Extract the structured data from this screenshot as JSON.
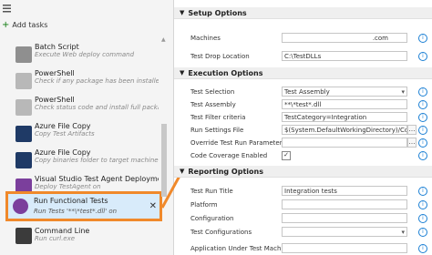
{
  "sidebar": {
    "add_tasks_label": "Add tasks",
    "tasks": [
      {
        "name": "Batch Script",
        "desc": "Execute Web deploy command",
        "icon": "batch-script-icon",
        "color": "#8f8f8f"
      },
      {
        "name": "PowerShell",
        "desc": "Check if any package has been installed",
        "icon": "powershell-icon",
        "color": "#9c9c9c"
      },
      {
        "name": "PowerShell",
        "desc": "Check status code and install full package if n",
        "icon": "powershell-icon",
        "color": "#9c9c9c"
      },
      {
        "name": "Azure File Copy",
        "desc": "Copy Test Artifacts",
        "icon": "azure-file-copy-icon",
        "color": "#1f3a66"
      },
      {
        "name": "Azure File Copy",
        "desc": "Copy binaries folder to target machine",
        "icon": "azure-file-copy-icon",
        "color": "#1f3a66"
      },
      {
        "name": "Visual Studio Test Agent Deployment",
        "desc": "Deploy TestAgent on",
        "icon": "test-agent-icon",
        "color": "#7b3f9c"
      }
    ],
    "selected_task": {
      "name": "Run Functional Tests",
      "desc": "Run Tests '**\\*test*.dll' on"
    },
    "last_task": {
      "name": "Command Line",
      "desc": "Run curl.exe"
    }
  },
  "setup": {
    "title": "Setup Options",
    "machines_label": "Machines",
    "machines_value": ".com",
    "drop_label": "Test Drop Location",
    "drop_value": "C:\\TestDLLs"
  },
  "execution": {
    "title": "Execution Options",
    "rows": [
      {
        "label": "Test Selection",
        "value": "Test Assembly"
      },
      {
        "label": "Test Assembly",
        "value": "**\\*test*.dll"
      },
      {
        "label": "Test Filter criteria",
        "value": "TestCategory=Integration"
      },
      {
        "label": "Run Settings File",
        "value": "$(System.DefaultWorkingDirectory)/Continuo"
      }
    ],
    "override_label": "Override Test Run Parameters",
    "coverage_label": "Code Coverage Enabled"
  },
  "reporting": {
    "title": "Reporting Options",
    "rows": [
      {
        "label": "Test Run Title",
        "value": "Integration tests"
      },
      {
        "label": "Platform",
        "value": ""
      },
      {
        "label": "Configuration",
        "value": ""
      },
      {
        "label": "Test Configurations",
        "value": ""
      },
      {
        "label": "Application Under Test Machines",
        "value": ""
      }
    ]
  },
  "colors": {
    "accent": "#f0892b",
    "selection": "#d8ebfa",
    "info": "#1a7fd4"
  }
}
